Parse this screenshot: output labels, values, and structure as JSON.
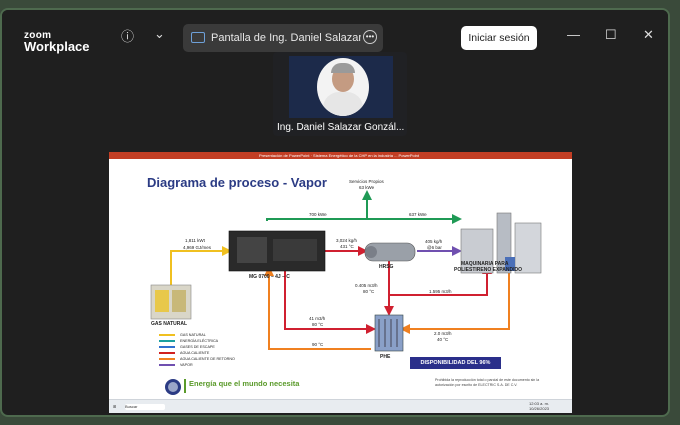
{
  "app": {
    "logo_line1": "zoom",
    "logo_line2": "Workplace"
  },
  "toolbar": {
    "share_text": "Pantalla de Ing. Daniel Salazar Go",
    "signin_label": "Iniciar sesión"
  },
  "participant": {
    "name": "Ing. Daniel Salazar Gonzál..."
  },
  "ppt": {
    "window_title": "Presentación de PowerPoint · Sistema Energético de la CHP en la industria ... PowerPoint"
  },
  "slide": {
    "title": "Diagrama de proceso - Vapor",
    "servicios": "Servicios Propios",
    "servicios_kw": "63 kWe",
    "kw_700": "700 kWe",
    "kw_637": "637 kWe",
    "gas_flow_1": "1,811 kWt",
    "gas_flow_2": "4,969 GJ/mes",
    "gas_natural": "GAS NATURAL",
    "engine": "MG 0700 – 4J – C",
    "steam_1": "3,024 kg/h",
    "steam_2": "431 °C",
    "hrsg": "HRSG",
    "vapor_1": "405 kg/h",
    "vapor_2": "@6 bar",
    "maquinaria_1": "MAQUINARIA PARA",
    "maquinaria_2": "POLIESTIRENO EXPANDIDO",
    "w_0405_1": "0.405 m3/h",
    "w_0405_2": "80 °C",
    "w_1595": "1.595 m3/h",
    "w_41_1": "41 m3/h",
    "w_41_2": "80 °C",
    "t_90": "90 °C",
    "w_20_1": "2.0 m3/h",
    "w_20_2": "40 °C",
    "phe": "PHE",
    "disponibilidad": "DISPONIBILIDAD DEL 96%",
    "tagline": "Energía que el mundo necesita",
    "disclaimer": "Prohibida la reproducción total o parcial de este documento sin la autorización por escrito de ELECTRIC S.A. DE C.V."
  },
  "legend": [
    {
      "label": "GAS NATURAL",
      "color": "#f0c020"
    },
    {
      "label": "ENERGÍA ELÉCTRICA",
      "color": "#1aa0a0"
    },
    {
      "label": "GASES DE ESCAPE",
      "color": "#3070d0"
    },
    {
      "label": "AGUA CALIENTE",
      "color": "#d02020"
    },
    {
      "label": "AGUA CALIENTE  DE RETORNO",
      "color": "#f08020"
    },
    {
      "label": "VAPOR",
      "color": "#7050b0"
    }
  ],
  "colors": {
    "electric": "#1f9a55",
    "gas": "#f0c020",
    "hot": "#d02030",
    "return": "#f08020",
    "vapor": "#7050b0",
    "exhaust": "#3070d0",
    "title": "#2b3b84"
  },
  "taskbar": {
    "search": "Buscar",
    "time": "12:03 a. m.",
    "date": "10/26/2023"
  }
}
